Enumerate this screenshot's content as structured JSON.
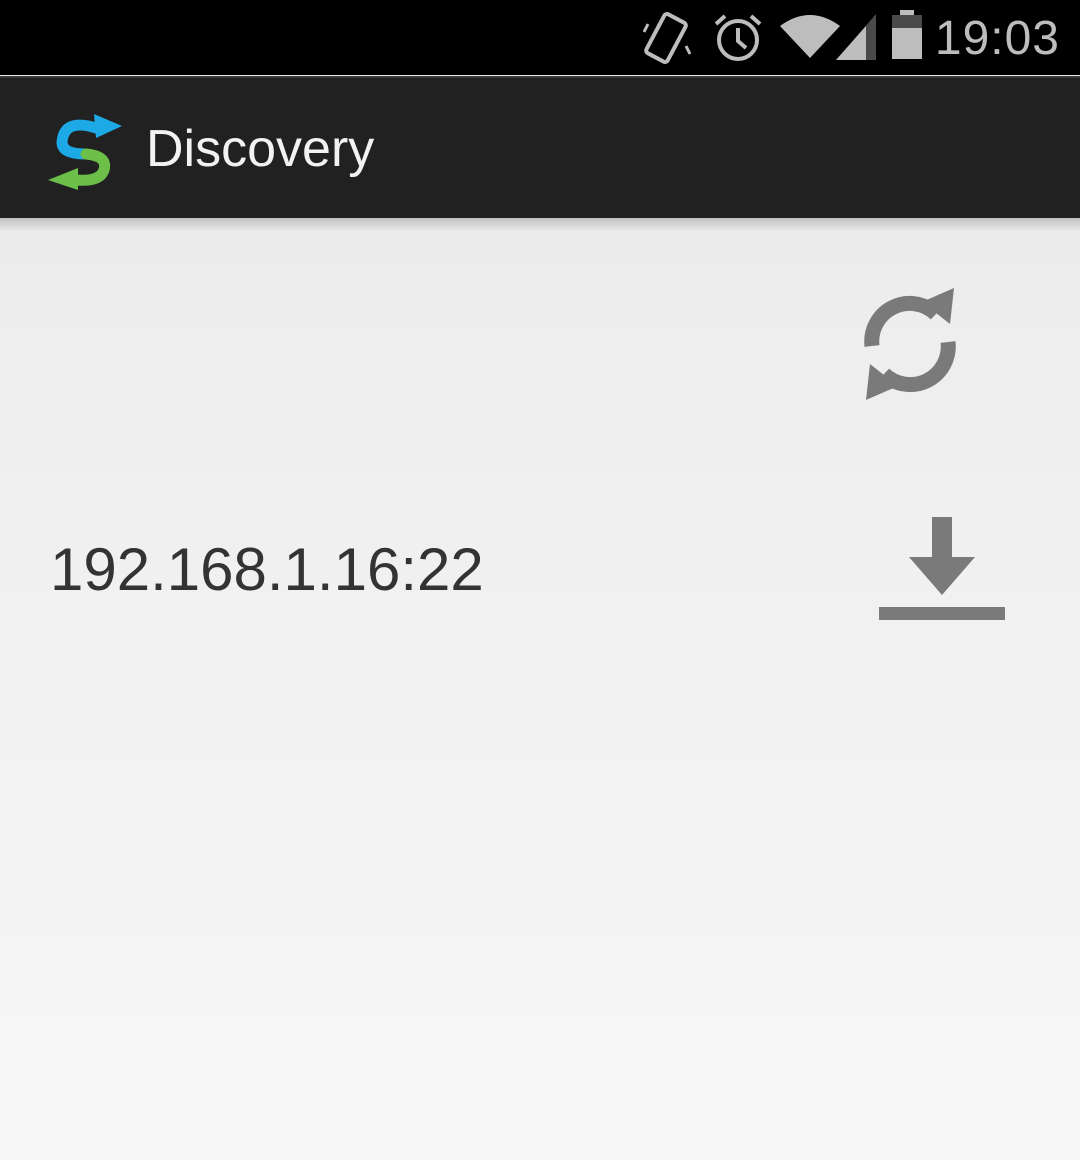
{
  "status_bar": {
    "time": "19:03",
    "icons": [
      "vibrate-icon",
      "alarm-icon",
      "wifi-icon",
      "signal-icon",
      "battery-icon"
    ],
    "text_color": "#bdbdbd"
  },
  "action_bar": {
    "title": "Discovery",
    "logo_icon": "app-logo-icon",
    "background": "#212121"
  },
  "content": {
    "refresh_icon": "refresh-icon",
    "hosts": [
      {
        "address": "192.168.1.16:22",
        "action_icon": "download-icon"
      }
    ]
  },
  "colors": {
    "icon_gray": "#7a7a7a",
    "logo_blue": "#1da9e6",
    "logo_green": "#6cc04a"
  }
}
